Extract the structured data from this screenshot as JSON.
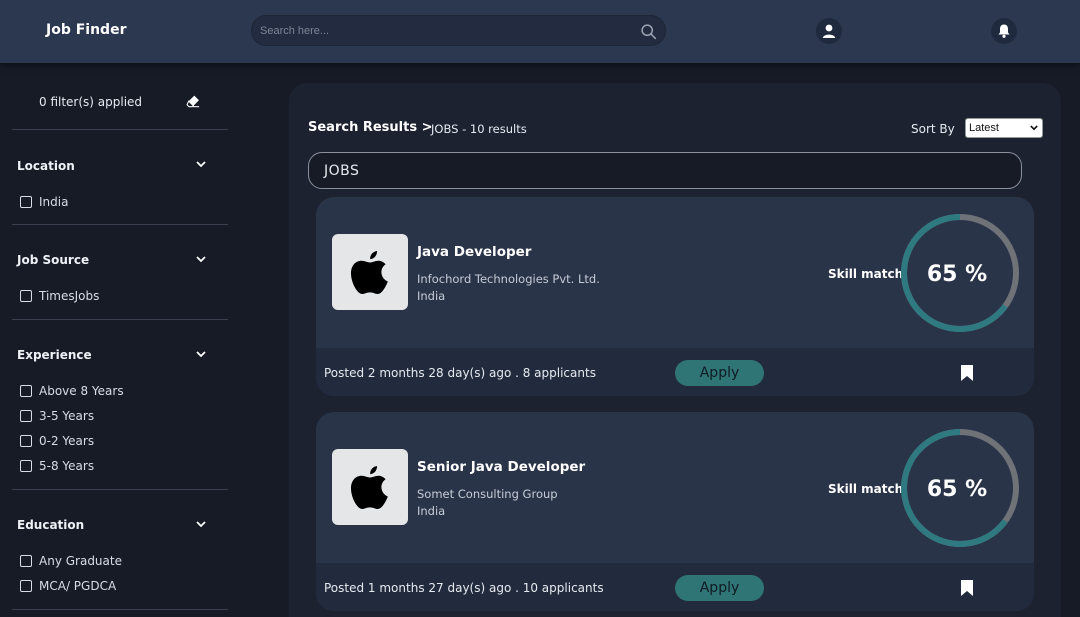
{
  "header": {
    "brand": "Job Finder",
    "search_placeholder": "Search here..."
  },
  "sidebar": {
    "filters_applied": "0 filter(s) applied",
    "sections": [
      {
        "title": "Location",
        "options": [
          "India"
        ]
      },
      {
        "title": "Job Source",
        "options": [
          "TimesJobs"
        ]
      },
      {
        "title": "Experience",
        "options": [
          "Above 8 Years",
          "3-5 Years",
          "0-2 Years",
          "5-8 Years"
        ]
      },
      {
        "title": "Education",
        "options": [
          "Any Graduate",
          "MCA/ PGDCA"
        ]
      }
    ]
  },
  "results": {
    "breadcrumb": "Search Results >",
    "subtitle": "JOBS - 10 results",
    "sort_label": "Sort By",
    "sort_value": "Latest",
    "query_value": "JOBS",
    "skill_label": "Skill match",
    "apply_label": "Apply"
  },
  "jobs": [
    {
      "title": "Java Developer",
      "company": "Infochord Technologies Pvt. Ltd.",
      "location": "India",
      "skill_match_text": "65 %",
      "skill_match_fraction": 0.65,
      "posted": "Posted 2 months 28 day(s) ago . 8 applicants"
    },
    {
      "title": "Senior Java Developer",
      "company": "Somet Consulting Group",
      "location": "India",
      "skill_match_text": "65 %",
      "skill_match_fraction": 0.65,
      "posted": "Posted 1 months 27 day(s) ago . 10 applicants"
    }
  ],
  "colors": {
    "ring_fill": "#2e7a80",
    "ring_track": "#6f7277",
    "apply_bg": "#2f7575",
    "header_bg": "#2c3750",
    "card_bg": "#2a3449"
  }
}
